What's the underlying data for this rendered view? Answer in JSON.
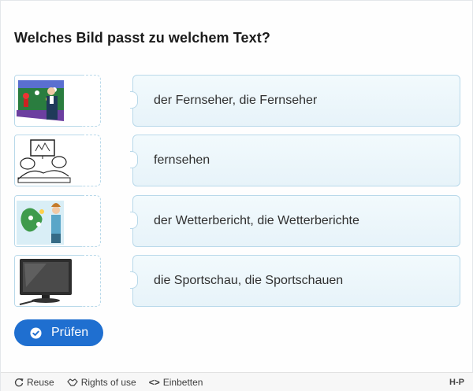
{
  "question": "Welches Bild passt zu welchem Text?",
  "rows": [
    {
      "image": "sportscast-image",
      "text": "der Fernseher, die Fernseher"
    },
    {
      "image": "watching-tv-image",
      "text": "fernsehen"
    },
    {
      "image": "weather-report-image",
      "text": "der Wetterbericht, die Wetterberichte"
    },
    {
      "image": "tv-set-image",
      "text": "die Sportschau, die Sportschauen"
    }
  ],
  "check_button": {
    "label": "Prüfen",
    "icon": "check-circle-icon"
  },
  "footer": {
    "reuse": "Reuse",
    "rights": "Rights of use",
    "embed": "Einbetten",
    "logo": "H-P"
  },
  "colors": {
    "accent": "#1f6fd0",
    "tile_border": "#b9d9ea",
    "tile_bg": "#eaf5fa"
  }
}
